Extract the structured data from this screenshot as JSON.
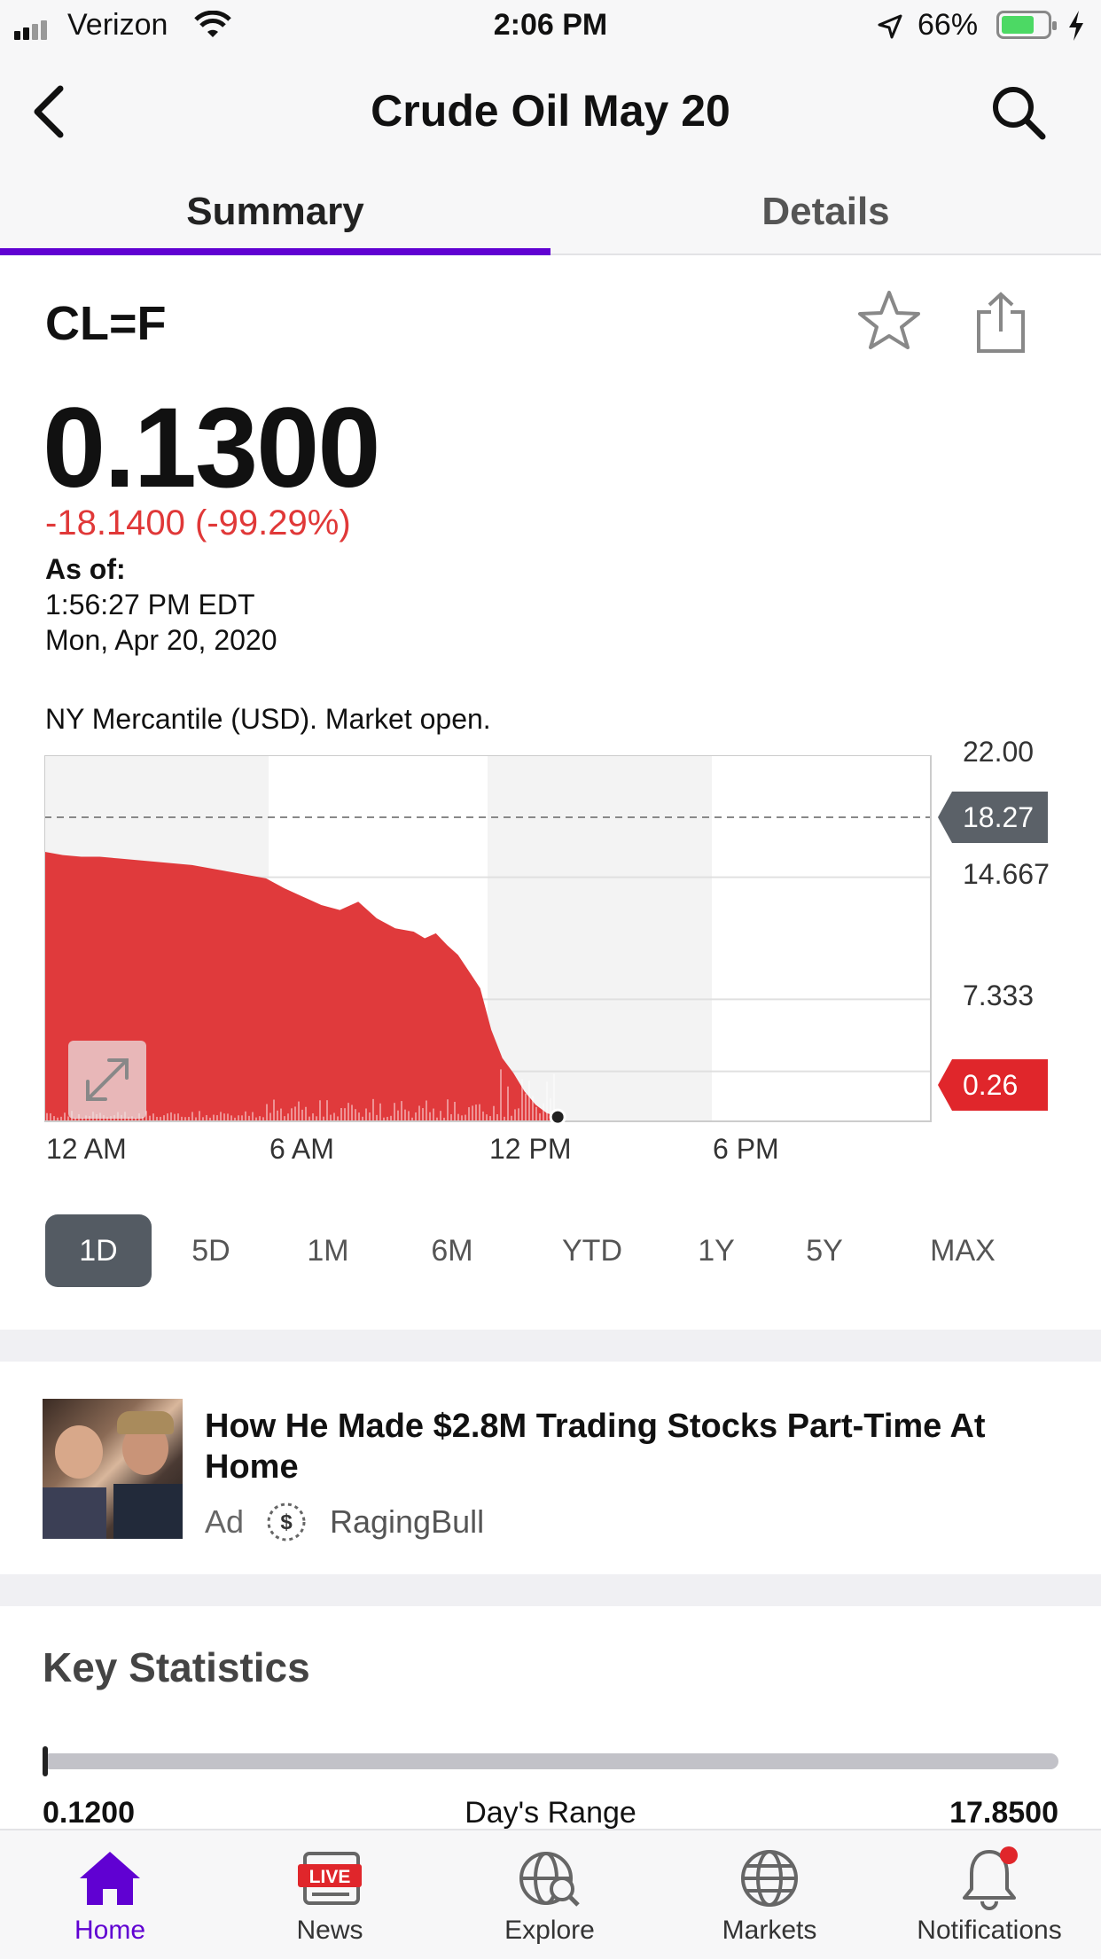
{
  "status_bar": {
    "carrier": "Verizon",
    "time": "2:06 PM",
    "battery": "66%"
  },
  "nav": {
    "title": "Crude Oil May 20"
  },
  "tabs": [
    {
      "label": "Summary",
      "active": true
    },
    {
      "label": "Details",
      "active": false
    }
  ],
  "quote": {
    "symbol": "CL=F",
    "price": "0.1300",
    "change": "-18.1400 (-99.29%)",
    "as_of_label": "As of:",
    "as_of_time": "1:56:27 PM EDT",
    "as_of_date": "Mon, Apr 20, 2020",
    "market_info": "NY Mercantile (USD). Market open."
  },
  "colors": {
    "accent": "#6001d2",
    "negative": "#e03838",
    "chart_fill": "#e03a3c",
    "active_range": "#545b63"
  },
  "chart_data": {
    "type": "area",
    "x_tick_labels": [
      "12 AM",
      "6 AM",
      "12 PM",
      "6 PM"
    ],
    "y_tick_labels": [
      "22.00",
      "14.667",
      "7.333"
    ],
    "ylim": [
      0,
      22
    ],
    "previous_close": 18.27,
    "previous_close_label": "18.27",
    "current_label": "0.26",
    "current": 0.26,
    "x_hours": [
      0,
      0.5,
      1,
      1.5,
      2,
      2.5,
      3,
      3.5,
      4,
      4.5,
      5,
      5.5,
      6,
      6.5,
      7,
      7.5,
      8,
      8.5,
      9,
      9.5,
      10,
      10.3,
      10.6,
      10.9,
      11.2,
      11.5,
      11.8,
      12.1,
      12.4,
      12.7,
      13,
      13.3,
      13.6,
      13.9
    ],
    "values": [
      16.2,
      16.0,
      15.9,
      15.9,
      15.8,
      15.7,
      15.6,
      15.5,
      15.4,
      15.2,
      15.0,
      14.8,
      14.6,
      14.0,
      13.5,
      13.0,
      12.7,
      13.2,
      12.2,
      11.6,
      11.4,
      11.0,
      11.3,
      10.6,
      10.0,
      9.0,
      8.0,
      5.5,
      3.8,
      2.9,
      1.8,
      1.0,
      0.5,
      0.26
    ],
    "grid": true
  },
  "ranges": [
    "1D",
    "5D",
    "1M",
    "6M",
    "YTD",
    "1Y",
    "5Y",
    "MAX"
  ],
  "active_range": "1D",
  "ad": {
    "title": "How He Made $2.8M Trading Stocks Part-Time At Home",
    "label": "Ad",
    "advertiser": "RagingBull"
  },
  "key_stats": {
    "heading": "Key Statistics",
    "range_low": "0.1200",
    "range_label": "Day's Range",
    "range_high": "17.8500",
    "range_position": 0.0
  },
  "bottom_tabs": [
    {
      "label": "Home",
      "icon": "home-icon",
      "active": true
    },
    {
      "label": "News",
      "icon": "live-news-icon",
      "active": false
    },
    {
      "label": "Explore",
      "icon": "explore-globe-icon",
      "active": false
    },
    {
      "label": "Markets",
      "icon": "globe-icon",
      "active": false
    },
    {
      "label": "Notifications",
      "icon": "bell-icon",
      "active": false
    }
  ]
}
